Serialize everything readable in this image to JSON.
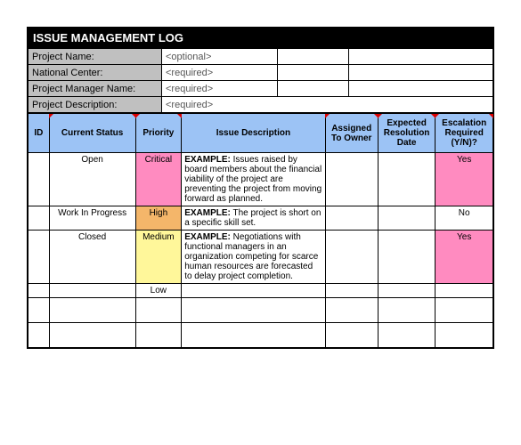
{
  "title": "ISSUE MANAGEMENT LOG",
  "meta": {
    "labels": {
      "project_name": "Project Name:",
      "national_center": "National Center:",
      "project_manager": "Project Manager Name:",
      "project_description": "Project Description:"
    },
    "values": {
      "project_name": "<optional>",
      "national_center": "<required>",
      "project_manager": "<required>",
      "project_description": "<required>"
    }
  },
  "headers": {
    "id": "ID",
    "status": "Current Status",
    "priority": "Priority",
    "desc": "Issue Description",
    "owner": "Assigned To Owner",
    "date": "Expected Resolution Date",
    "esc": "Escalation Required (Y/N)?"
  },
  "rows": [
    {
      "id": "",
      "status": "Open",
      "priority": "Critical",
      "priority_class": "pink",
      "desc_prefix": "EXAMPLE:",
      "desc": " Issues raised by board members about the financial viability of the project are preventing the project from moving forward as planned.",
      "owner": "",
      "date": "",
      "esc": "Yes",
      "esc_class": "pink"
    },
    {
      "id": "",
      "status": "Work In Progress",
      "priority": "High",
      "priority_class": "orange",
      "desc_prefix": "EXAMPLE:",
      "desc": " The project is short on a specific skill set.",
      "owner": "",
      "date": "",
      "esc": "No",
      "esc_class": ""
    },
    {
      "id": "",
      "status": "Closed",
      "priority": "Medium",
      "priority_class": "yellow",
      "desc_prefix": "EXAMPLE:",
      "desc": " Negotiations with functional managers in an organization competing for scarce human resources are forecasted to delay project completion.",
      "owner": "",
      "date": "",
      "esc": "Yes",
      "esc_class": "pink"
    },
    {
      "id": "",
      "status": "",
      "priority": "Low",
      "priority_class": "",
      "desc_prefix": "",
      "desc": "",
      "owner": "",
      "date": "",
      "esc": "",
      "esc_class": ""
    }
  ],
  "empty_rows": 2
}
